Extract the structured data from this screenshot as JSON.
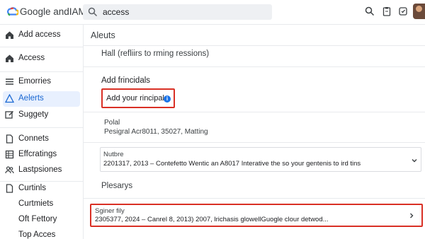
{
  "header": {
    "brand": "Google andIAM",
    "search_value": "access"
  },
  "sidebar": {
    "items": [
      {
        "label": "Add access",
        "icon": "home-icon"
      },
      {
        "label": "Access",
        "icon": "home-icon"
      },
      {
        "label": "Emorries",
        "icon": "list-icon"
      },
      {
        "label": "Aelerts",
        "icon": "alert-icon",
        "active": true
      },
      {
        "label": "Suggety",
        "icon": "edit-icon"
      },
      {
        "label": "Connets",
        "icon": "document-icon"
      },
      {
        "label": "Effcratings",
        "icon": "grid-icon"
      },
      {
        "label": "Lastpsiones",
        "icon": "people-icon"
      },
      {
        "label": "Curtinls",
        "icon": "document-icon"
      },
      {
        "label": "Curtmiets",
        "icon": ""
      },
      {
        "label": "Oft Fettory",
        "icon": ""
      },
      {
        "label": "Top Acces",
        "icon": ""
      }
    ]
  },
  "main": {
    "title": "Aleuts",
    "hall_text": "Hall (refliirs to rming ressions)",
    "section_title": "Add frincidals",
    "add_principal_label": "Add your rincipal",
    "info_glyph": "i",
    "polal_title": "Polal",
    "polal_detail": "Pesigral Acr8011, 35027, Matting",
    "nutbre_card": {
      "title": "Nutbre",
      "detail": "2201317, 2013 – Contefetto Wentic an A8017 Interative the so your gentenis to ird tins"
    },
    "plesarys_title": "Plesarys",
    "signer_card": {
      "title": "Sginer fily",
      "detail": "2305377, 2024 – Canrel 8, 2013) 2007, lrichasis glowellGuogle clour detwod..."
    }
  },
  "colors": {
    "accent": "#1a73e8",
    "highlight": "#d93025",
    "active_bg": "#e8f0fe"
  }
}
